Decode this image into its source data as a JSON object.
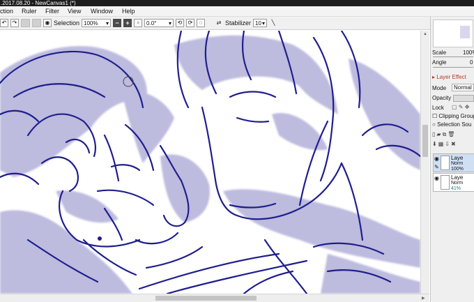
{
  "window": {
    "title": ".2017.08.20 - NewCanvas1 (*)"
  },
  "menu": [
    "ction",
    "Ruler",
    "Filter",
    "View",
    "Window",
    "Help"
  ],
  "toolbar": {
    "selection_label": "Selection",
    "zoom": "100%",
    "zoom_minus": "−",
    "zoom_plus": "+",
    "rotation": "0.0°",
    "stabilizer_label": "Stabilizer",
    "stabilizer_value": "10"
  },
  "panel": {
    "scale_label": "Scale",
    "scale_value": "100%",
    "angle_label": "Angle",
    "angle_value": "0",
    "layer_effect": "Layer Effect",
    "mode_label": "Mode",
    "mode_value": "Normal",
    "opacity_label": "Opacity",
    "lock_label": "Lock",
    "clipping_group": "Clipping Group",
    "selection_source": "Selection Sou",
    "layers": [
      {
        "name": "Laye",
        "mode": "Norm",
        "opacity": "100%"
      },
      {
        "name": "Laye",
        "mode": "Norm",
        "opacity": "41%"
      }
    ]
  },
  "colors": {
    "lineart": "#1f1e8c",
    "shading": "#a7a5d4"
  }
}
